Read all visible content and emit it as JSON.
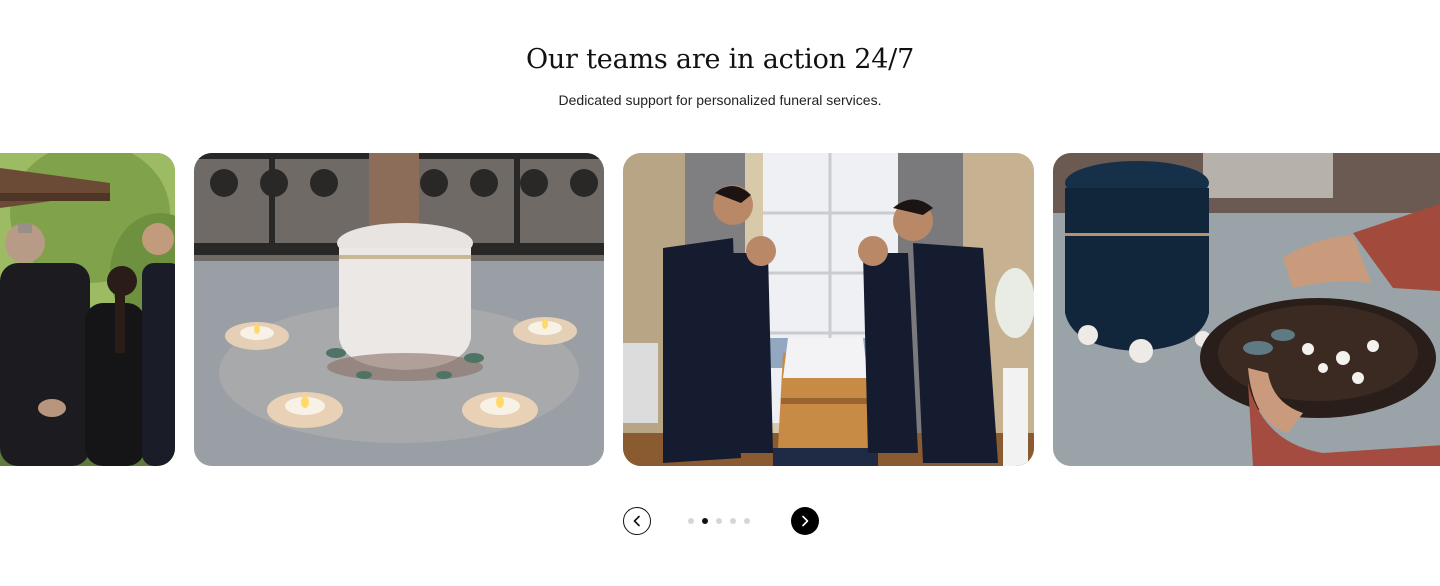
{
  "header": {
    "title": "Our teams are in action 24/7",
    "subtitle": "Dedicated support for personalized funeral services."
  },
  "carousel": {
    "slides": [
      {
        "subject": "mourners standing outdoors in dark suits"
      },
      {
        "subject": "white ceramic urn with tealight candles"
      },
      {
        "subject": "funeral staff bowing beside a wooden coffin"
      },
      {
        "subject": "dark blue urn and hands holding a bowl of flower petals"
      }
    ],
    "dot_count": 5,
    "active_dot": 1,
    "prev_icon": "chevron-left-icon",
    "next_icon": "chevron-right-icon"
  },
  "colors": {
    "text": "#111111",
    "next_button_bg": "#000000",
    "dot_inactive": "#d6d6d6",
    "dot_active": "#111111"
  }
}
